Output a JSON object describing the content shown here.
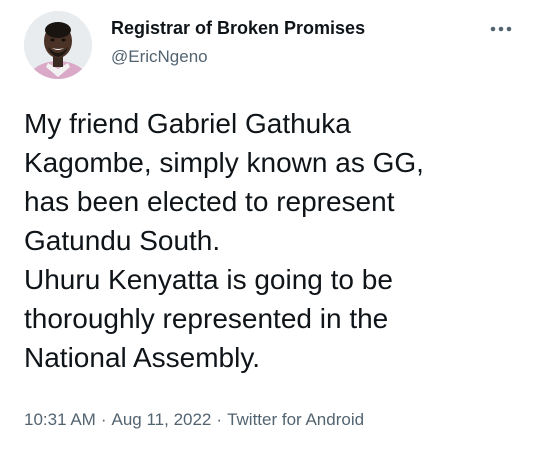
{
  "author": {
    "display_name": "Registrar of Broken Promises",
    "handle": "@EricNgeno"
  },
  "tweet": {
    "lines": [
      "My friend Gabriel Gathuka",
      "Kagombe, simply known as GG,",
      "has been elected to represent",
      "Gatundu South.",
      "Uhuru Kenyatta is going to be",
      "thoroughly represented in the",
      "National Assembly."
    ]
  },
  "meta": {
    "time": "10:31 AM",
    "date": "Aug 11, 2022",
    "source": "Twitter for Android",
    "separator": "·"
  },
  "icons": {
    "more": "more-horizontal-icon"
  },
  "colors": {
    "text_primary": "#0f1419",
    "text_secondary": "#536471",
    "background": "#ffffff"
  }
}
